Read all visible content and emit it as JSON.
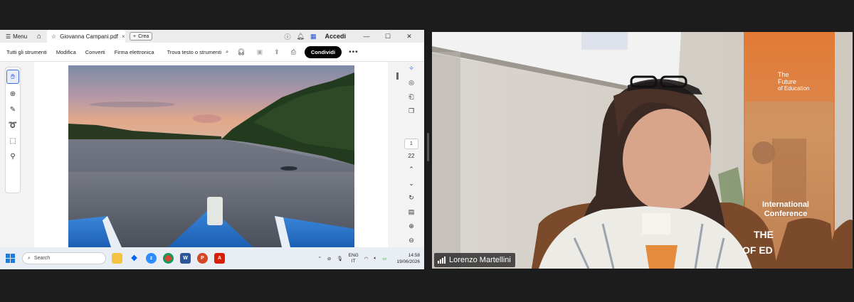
{
  "window": {
    "menu_label": "Menu",
    "tab_title": "Giovanna Campani.pdf",
    "new_button": "Crea",
    "signin": "Accedi"
  },
  "toolbar": {
    "items": [
      "Tutti gli strumenti",
      "Modifica",
      "Converti",
      "Firma elettronica"
    ],
    "find_label": "Trova testo o strumenti",
    "share_button": "Condividi"
  },
  "page_nav": {
    "current": "1",
    "total": "22"
  },
  "taskbar": {
    "search_placeholder": "Search",
    "lang": "ENG",
    "region": "IT",
    "time": "14:58",
    "date": "19/06/2026"
  },
  "video": {
    "participant_name": "Lorenzo Martellini",
    "banner_lines": [
      "The",
      "Future",
      "of Education"
    ],
    "conference_text": "International Conference",
    "banner_bottom": "THE",
    "banner_bottom2": "OF ED"
  },
  "icons": {
    "left_rail": [
      "select-hand-icon",
      "comment-icon",
      "draw-icon",
      "lasso-icon",
      "text-recognize-icon",
      "stamp-icon"
    ],
    "right_rail": [
      "ai-assistant-icon",
      "comments-panel-icon",
      "bookmark-icon",
      "pages-icon",
      "scroll-up-icon",
      "scroll-down-icon",
      "rotate-icon",
      "page-extract-icon",
      "zoom-in-icon",
      "zoom-out-icon"
    ]
  },
  "colors": {
    "accent_blue": "#1d4fd8",
    "banner_orange": "#e2742b",
    "condividi_bg": "#000000"
  }
}
